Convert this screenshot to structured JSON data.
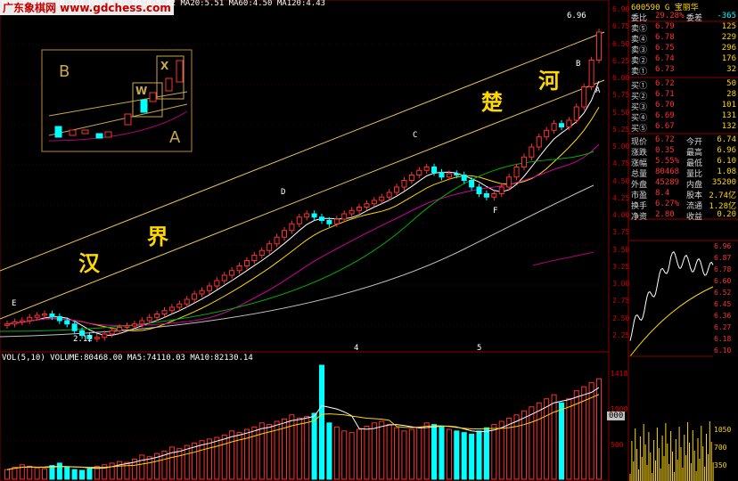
{
  "watermark": "广东象棋网 www.gdchess.com",
  "main_header": "MA1:20.01.120.243 MA5:6.22 MA10:5.82 MA20:5.51 MA60:4.50 MA120:4.43",
  "volume_header": "VOL(5,10) VOLUME:80468.00 MA5:74110.03 MA10:82130.14",
  "chart_labels": {
    "B_top": "B",
    "A_top": "A",
    "C": "C",
    "D": "D",
    "E": "E",
    "F": "F",
    "max_price": "6.96",
    "min_price": "2.12",
    "m1": "4",
    "m2": "5"
  },
  "chinese": {
    "han": "汉",
    "jie": "界",
    "chu": "楚",
    "he": "河"
  },
  "inset": {
    "B": "B",
    "A": "A",
    "W": "W",
    "X": "X"
  },
  "price_axis": [
    "6.90",
    "6.75",
    "6.50",
    "6.25",
    "6.00",
    "5.75",
    "5.50",
    "5.25",
    "5.00",
    "4.75",
    "4.50",
    "4.25",
    "4.00",
    "3.75",
    "3.50",
    "3.25",
    "3.00",
    "2.75",
    "2.50",
    "2.25"
  ],
  "vol_axis": [
    "1418",
    "1000",
    "500"
  ],
  "vol_badge": "000",
  "quote": {
    "code": "600590 G 宝丽华",
    "ratio": {
      "label": "委比",
      "value": "29.28%",
      "label2": "委差",
      "value2": "-365"
    },
    "sells": [
      {
        "label": "卖⑤",
        "price": "6.79",
        "vol": "125"
      },
      {
        "label": "卖④",
        "price": "6.78",
        "vol": "229"
      },
      {
        "label": "卖③",
        "price": "6.75",
        "vol": "296"
      },
      {
        "label": "卖②",
        "price": "6.74",
        "vol": "176"
      },
      {
        "label": "卖①",
        "price": "6.73",
        "vol": "32"
      }
    ],
    "buys": [
      {
        "label": "买①",
        "price": "6.72",
        "vol": "50"
      },
      {
        "label": "买②",
        "price": "6.71",
        "vol": "28"
      },
      {
        "label": "买③",
        "price": "6.70",
        "vol": "101"
      },
      {
        "label": "买④",
        "price": "6.69",
        "vol": "131"
      },
      {
        "label": "买⑤",
        "price": "6.67",
        "vol": "132"
      }
    ],
    "stats": [
      {
        "l1": "现价",
        "v1": "6.72",
        "l2": "今开",
        "v2": "6.74"
      },
      {
        "l1": "涨跌",
        "v1": "0.35",
        "l2": "最高",
        "v2": "6.96"
      },
      {
        "l1": "涨幅",
        "v1": "5.55%",
        "l2": "最低",
        "v2": "6.10"
      },
      {
        "l1": "总量",
        "v1": "80468",
        "l2": "量比",
        "v2": "1.08"
      },
      {
        "l1": "外盘",
        "v1": "45289",
        "l2": "内盘",
        "v2": "35200"
      },
      {
        "l1": "市盈",
        "v1": "8.4",
        "l2": "股本",
        "v2": "2.74亿"
      },
      {
        "l1": "换手",
        "v1": "6.27%",
        "l2": "流通",
        "v2": "1.28亿"
      },
      {
        "l1": "净资",
        "v1": "2.80",
        "l2": "收益",
        "v2": "0.20"
      }
    ]
  },
  "mini_axis": [
    "6.96",
    "6.87",
    "6.78",
    "6.60",
    "6.52",
    "6.45",
    "6.36",
    "6.27",
    "6.18",
    "6.10"
  ],
  "mini_vol_axis": [
    "1050",
    "700",
    "350"
  ],
  "chart_data": {
    "type": "candlestick",
    "title": "",
    "ylim": [
      2.0,
      7.0
    ],
    "closes": [
      2.35,
      2.38,
      2.4,
      2.45,
      2.48,
      2.5,
      2.46,
      2.4,
      2.35,
      2.25,
      2.18,
      2.13,
      2.15,
      2.2,
      2.25,
      2.3,
      2.32,
      2.35,
      2.4,
      2.45,
      2.5,
      2.55,
      2.6,
      2.65,
      2.72,
      2.8,
      2.85,
      2.92,
      3.0,
      3.08,
      3.15,
      3.22,
      3.3,
      3.38,
      3.45,
      3.55,
      3.65,
      3.75,
      3.85,
      3.95,
      4.0,
      3.95,
      3.9,
      3.85,
      3.92,
      4.0,
      4.05,
      4.1,
      4.15,
      4.2,
      4.25,
      4.32,
      4.4,
      4.5,
      4.58,
      4.65,
      4.7,
      4.62,
      4.55,
      4.6,
      4.58,
      4.5,
      4.4,
      4.3,
      4.25,
      4.3,
      4.4,
      4.55,
      4.7,
      4.85,
      5.0,
      5.15,
      5.25,
      5.35,
      5.3,
      5.4,
      5.6,
      5.9,
      6.3,
      6.72
    ],
    "volumes": [
      120,
      150,
      180,
      160,
      140,
      130,
      170,
      200,
      150,
      120,
      110,
      130,
      160,
      180,
      200,
      220,
      210,
      250,
      300,
      280,
      320,
      350,
      400,
      380,
      420,
      450,
      480,
      500,
      520,
      550,
      600,
      580,
      620,
      650,
      700,
      680,
      720,
      750,
      800,
      760,
      780,
      820,
      1418,
      700,
      650,
      600,
      580,
      620,
      660,
      700,
      720,
      680,
      640,
      600,
      620,
      650,
      700,
      680,
      650,
      620,
      600,
      580,
      560,
      600,
      640,
      680,
      720,
      760,
      800,
      850,
      900,
      950,
      1000,
      1050,
      950,
      1000,
      1100,
      1150,
      1200,
      1250
    ]
  }
}
